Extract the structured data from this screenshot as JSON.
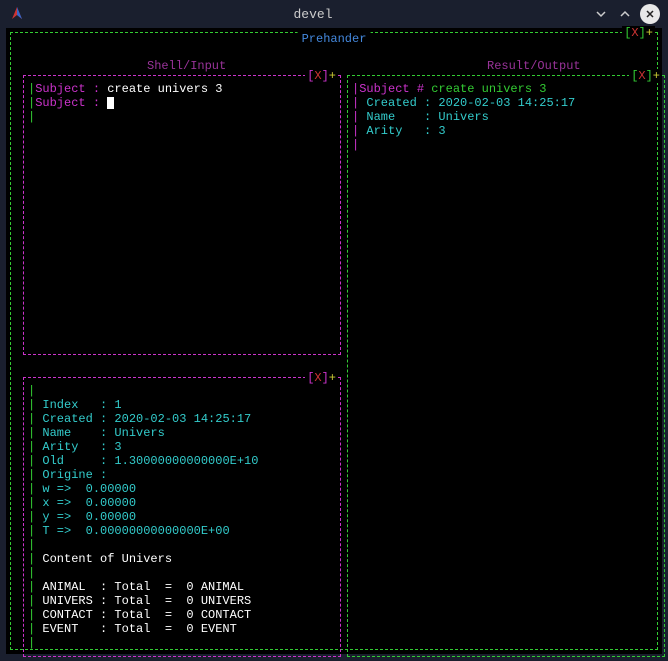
{
  "window": {
    "title": "devel"
  },
  "outer": {
    "title": "Prehander",
    "close": "[X]+"
  },
  "panels": {
    "shell_title": "Shell/Input",
    "output_title": "Result/Output"
  },
  "shell": {
    "line1_label": "Subject :",
    "line1_value": " create univers 3",
    "line2_label": "Subject :"
  },
  "output": {
    "subject_label": "Subject #",
    "subject_value": " create univers 3",
    "created_label": " Created :",
    "created_value": " 2020-02-03 14:25:17",
    "name_label": " Name    :",
    "name_value": " Univers",
    "arity_label": " Arity   :",
    "arity_value": " 3"
  },
  "detail": {
    "index_label": " Index   :",
    "index_value": " 1",
    "created_label": " Created :",
    "created_value": " 2020-02-03 14:25:17",
    "name_label": " Name    :",
    "name_value": " Univers",
    "arity_label": " Arity   :",
    "arity_value": " 3",
    "old_label": " Old     :",
    "old_value": " 1.30000000000000E+10",
    "origine_label": " Origine :",
    "w_label": " w =>  ",
    "w_value": "0.00000",
    "x_label": " x =>  ",
    "x_value": "0.00000",
    "y_label": " y =>  ",
    "y_value": "0.00000",
    "t_label": " T =>  ",
    "t_value": "0.00000000000000E+00",
    "content_title": " Content of Univers",
    "row1": " ANIMAL  : Total  =  0 ANIMAL",
    "row2": " UNIVERS : Total  =  0 UNIVERS",
    "row3": " CONTACT : Total  =  0 CONTACT",
    "row4": " EVENT   : Total  =  0 EVENT"
  }
}
